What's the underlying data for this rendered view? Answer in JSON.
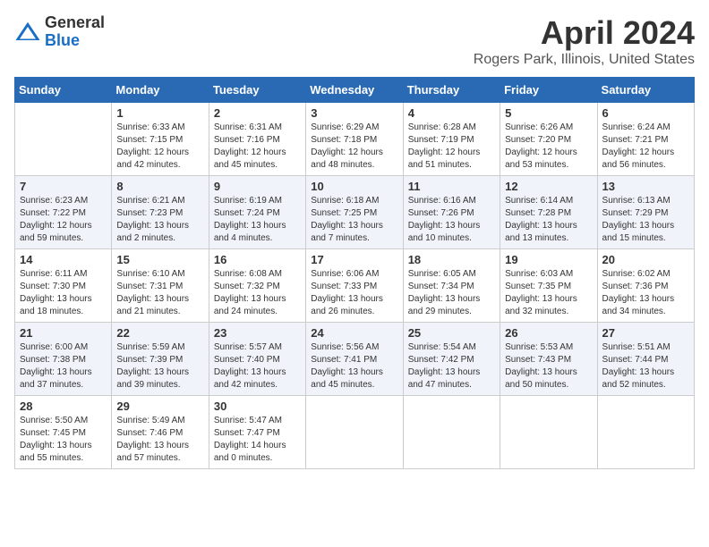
{
  "header": {
    "logo_general": "General",
    "logo_blue": "Blue",
    "month_title": "April 2024",
    "location": "Rogers Park, Illinois, United States"
  },
  "days_of_week": [
    "Sunday",
    "Monday",
    "Tuesday",
    "Wednesday",
    "Thursday",
    "Friday",
    "Saturday"
  ],
  "weeks": [
    [
      {
        "day": "",
        "sunrise": "",
        "sunset": "",
        "daylight": ""
      },
      {
        "day": "1",
        "sunrise": "Sunrise: 6:33 AM",
        "sunset": "Sunset: 7:15 PM",
        "daylight": "Daylight: 12 hours and 42 minutes."
      },
      {
        "day": "2",
        "sunrise": "Sunrise: 6:31 AM",
        "sunset": "Sunset: 7:16 PM",
        "daylight": "Daylight: 12 hours and 45 minutes."
      },
      {
        "day": "3",
        "sunrise": "Sunrise: 6:29 AM",
        "sunset": "Sunset: 7:18 PM",
        "daylight": "Daylight: 12 hours and 48 minutes."
      },
      {
        "day": "4",
        "sunrise": "Sunrise: 6:28 AM",
        "sunset": "Sunset: 7:19 PM",
        "daylight": "Daylight: 12 hours and 51 minutes."
      },
      {
        "day": "5",
        "sunrise": "Sunrise: 6:26 AM",
        "sunset": "Sunset: 7:20 PM",
        "daylight": "Daylight: 12 hours and 53 minutes."
      },
      {
        "day": "6",
        "sunrise": "Sunrise: 6:24 AM",
        "sunset": "Sunset: 7:21 PM",
        "daylight": "Daylight: 12 hours and 56 minutes."
      }
    ],
    [
      {
        "day": "7",
        "sunrise": "Sunrise: 6:23 AM",
        "sunset": "Sunset: 7:22 PM",
        "daylight": "Daylight: 12 hours and 59 minutes."
      },
      {
        "day": "8",
        "sunrise": "Sunrise: 6:21 AM",
        "sunset": "Sunset: 7:23 PM",
        "daylight": "Daylight: 13 hours and 2 minutes."
      },
      {
        "day": "9",
        "sunrise": "Sunrise: 6:19 AM",
        "sunset": "Sunset: 7:24 PM",
        "daylight": "Daylight: 13 hours and 4 minutes."
      },
      {
        "day": "10",
        "sunrise": "Sunrise: 6:18 AM",
        "sunset": "Sunset: 7:25 PM",
        "daylight": "Daylight: 13 hours and 7 minutes."
      },
      {
        "day": "11",
        "sunrise": "Sunrise: 6:16 AM",
        "sunset": "Sunset: 7:26 PM",
        "daylight": "Daylight: 13 hours and 10 minutes."
      },
      {
        "day": "12",
        "sunrise": "Sunrise: 6:14 AM",
        "sunset": "Sunset: 7:28 PM",
        "daylight": "Daylight: 13 hours and 13 minutes."
      },
      {
        "day": "13",
        "sunrise": "Sunrise: 6:13 AM",
        "sunset": "Sunset: 7:29 PM",
        "daylight": "Daylight: 13 hours and 15 minutes."
      }
    ],
    [
      {
        "day": "14",
        "sunrise": "Sunrise: 6:11 AM",
        "sunset": "Sunset: 7:30 PM",
        "daylight": "Daylight: 13 hours and 18 minutes."
      },
      {
        "day": "15",
        "sunrise": "Sunrise: 6:10 AM",
        "sunset": "Sunset: 7:31 PM",
        "daylight": "Daylight: 13 hours and 21 minutes."
      },
      {
        "day": "16",
        "sunrise": "Sunrise: 6:08 AM",
        "sunset": "Sunset: 7:32 PM",
        "daylight": "Daylight: 13 hours and 24 minutes."
      },
      {
        "day": "17",
        "sunrise": "Sunrise: 6:06 AM",
        "sunset": "Sunset: 7:33 PM",
        "daylight": "Daylight: 13 hours and 26 minutes."
      },
      {
        "day": "18",
        "sunrise": "Sunrise: 6:05 AM",
        "sunset": "Sunset: 7:34 PM",
        "daylight": "Daylight: 13 hours and 29 minutes."
      },
      {
        "day": "19",
        "sunrise": "Sunrise: 6:03 AM",
        "sunset": "Sunset: 7:35 PM",
        "daylight": "Daylight: 13 hours and 32 minutes."
      },
      {
        "day": "20",
        "sunrise": "Sunrise: 6:02 AM",
        "sunset": "Sunset: 7:36 PM",
        "daylight": "Daylight: 13 hours and 34 minutes."
      }
    ],
    [
      {
        "day": "21",
        "sunrise": "Sunrise: 6:00 AM",
        "sunset": "Sunset: 7:38 PM",
        "daylight": "Daylight: 13 hours and 37 minutes."
      },
      {
        "day": "22",
        "sunrise": "Sunrise: 5:59 AM",
        "sunset": "Sunset: 7:39 PM",
        "daylight": "Daylight: 13 hours and 39 minutes."
      },
      {
        "day": "23",
        "sunrise": "Sunrise: 5:57 AM",
        "sunset": "Sunset: 7:40 PM",
        "daylight": "Daylight: 13 hours and 42 minutes."
      },
      {
        "day": "24",
        "sunrise": "Sunrise: 5:56 AM",
        "sunset": "Sunset: 7:41 PM",
        "daylight": "Daylight: 13 hours and 45 minutes."
      },
      {
        "day": "25",
        "sunrise": "Sunrise: 5:54 AM",
        "sunset": "Sunset: 7:42 PM",
        "daylight": "Daylight: 13 hours and 47 minutes."
      },
      {
        "day": "26",
        "sunrise": "Sunrise: 5:53 AM",
        "sunset": "Sunset: 7:43 PM",
        "daylight": "Daylight: 13 hours and 50 minutes."
      },
      {
        "day": "27",
        "sunrise": "Sunrise: 5:51 AM",
        "sunset": "Sunset: 7:44 PM",
        "daylight": "Daylight: 13 hours and 52 minutes."
      }
    ],
    [
      {
        "day": "28",
        "sunrise": "Sunrise: 5:50 AM",
        "sunset": "Sunset: 7:45 PM",
        "daylight": "Daylight: 13 hours and 55 minutes."
      },
      {
        "day": "29",
        "sunrise": "Sunrise: 5:49 AM",
        "sunset": "Sunset: 7:46 PM",
        "daylight": "Daylight: 13 hours and 57 minutes."
      },
      {
        "day": "30",
        "sunrise": "Sunrise: 5:47 AM",
        "sunset": "Sunset: 7:47 PM",
        "daylight": "Daylight: 14 hours and 0 minutes."
      },
      {
        "day": "",
        "sunrise": "",
        "sunset": "",
        "daylight": ""
      },
      {
        "day": "",
        "sunrise": "",
        "sunset": "",
        "daylight": ""
      },
      {
        "day": "",
        "sunrise": "",
        "sunset": "",
        "daylight": ""
      },
      {
        "day": "",
        "sunrise": "",
        "sunset": "",
        "daylight": ""
      }
    ]
  ]
}
